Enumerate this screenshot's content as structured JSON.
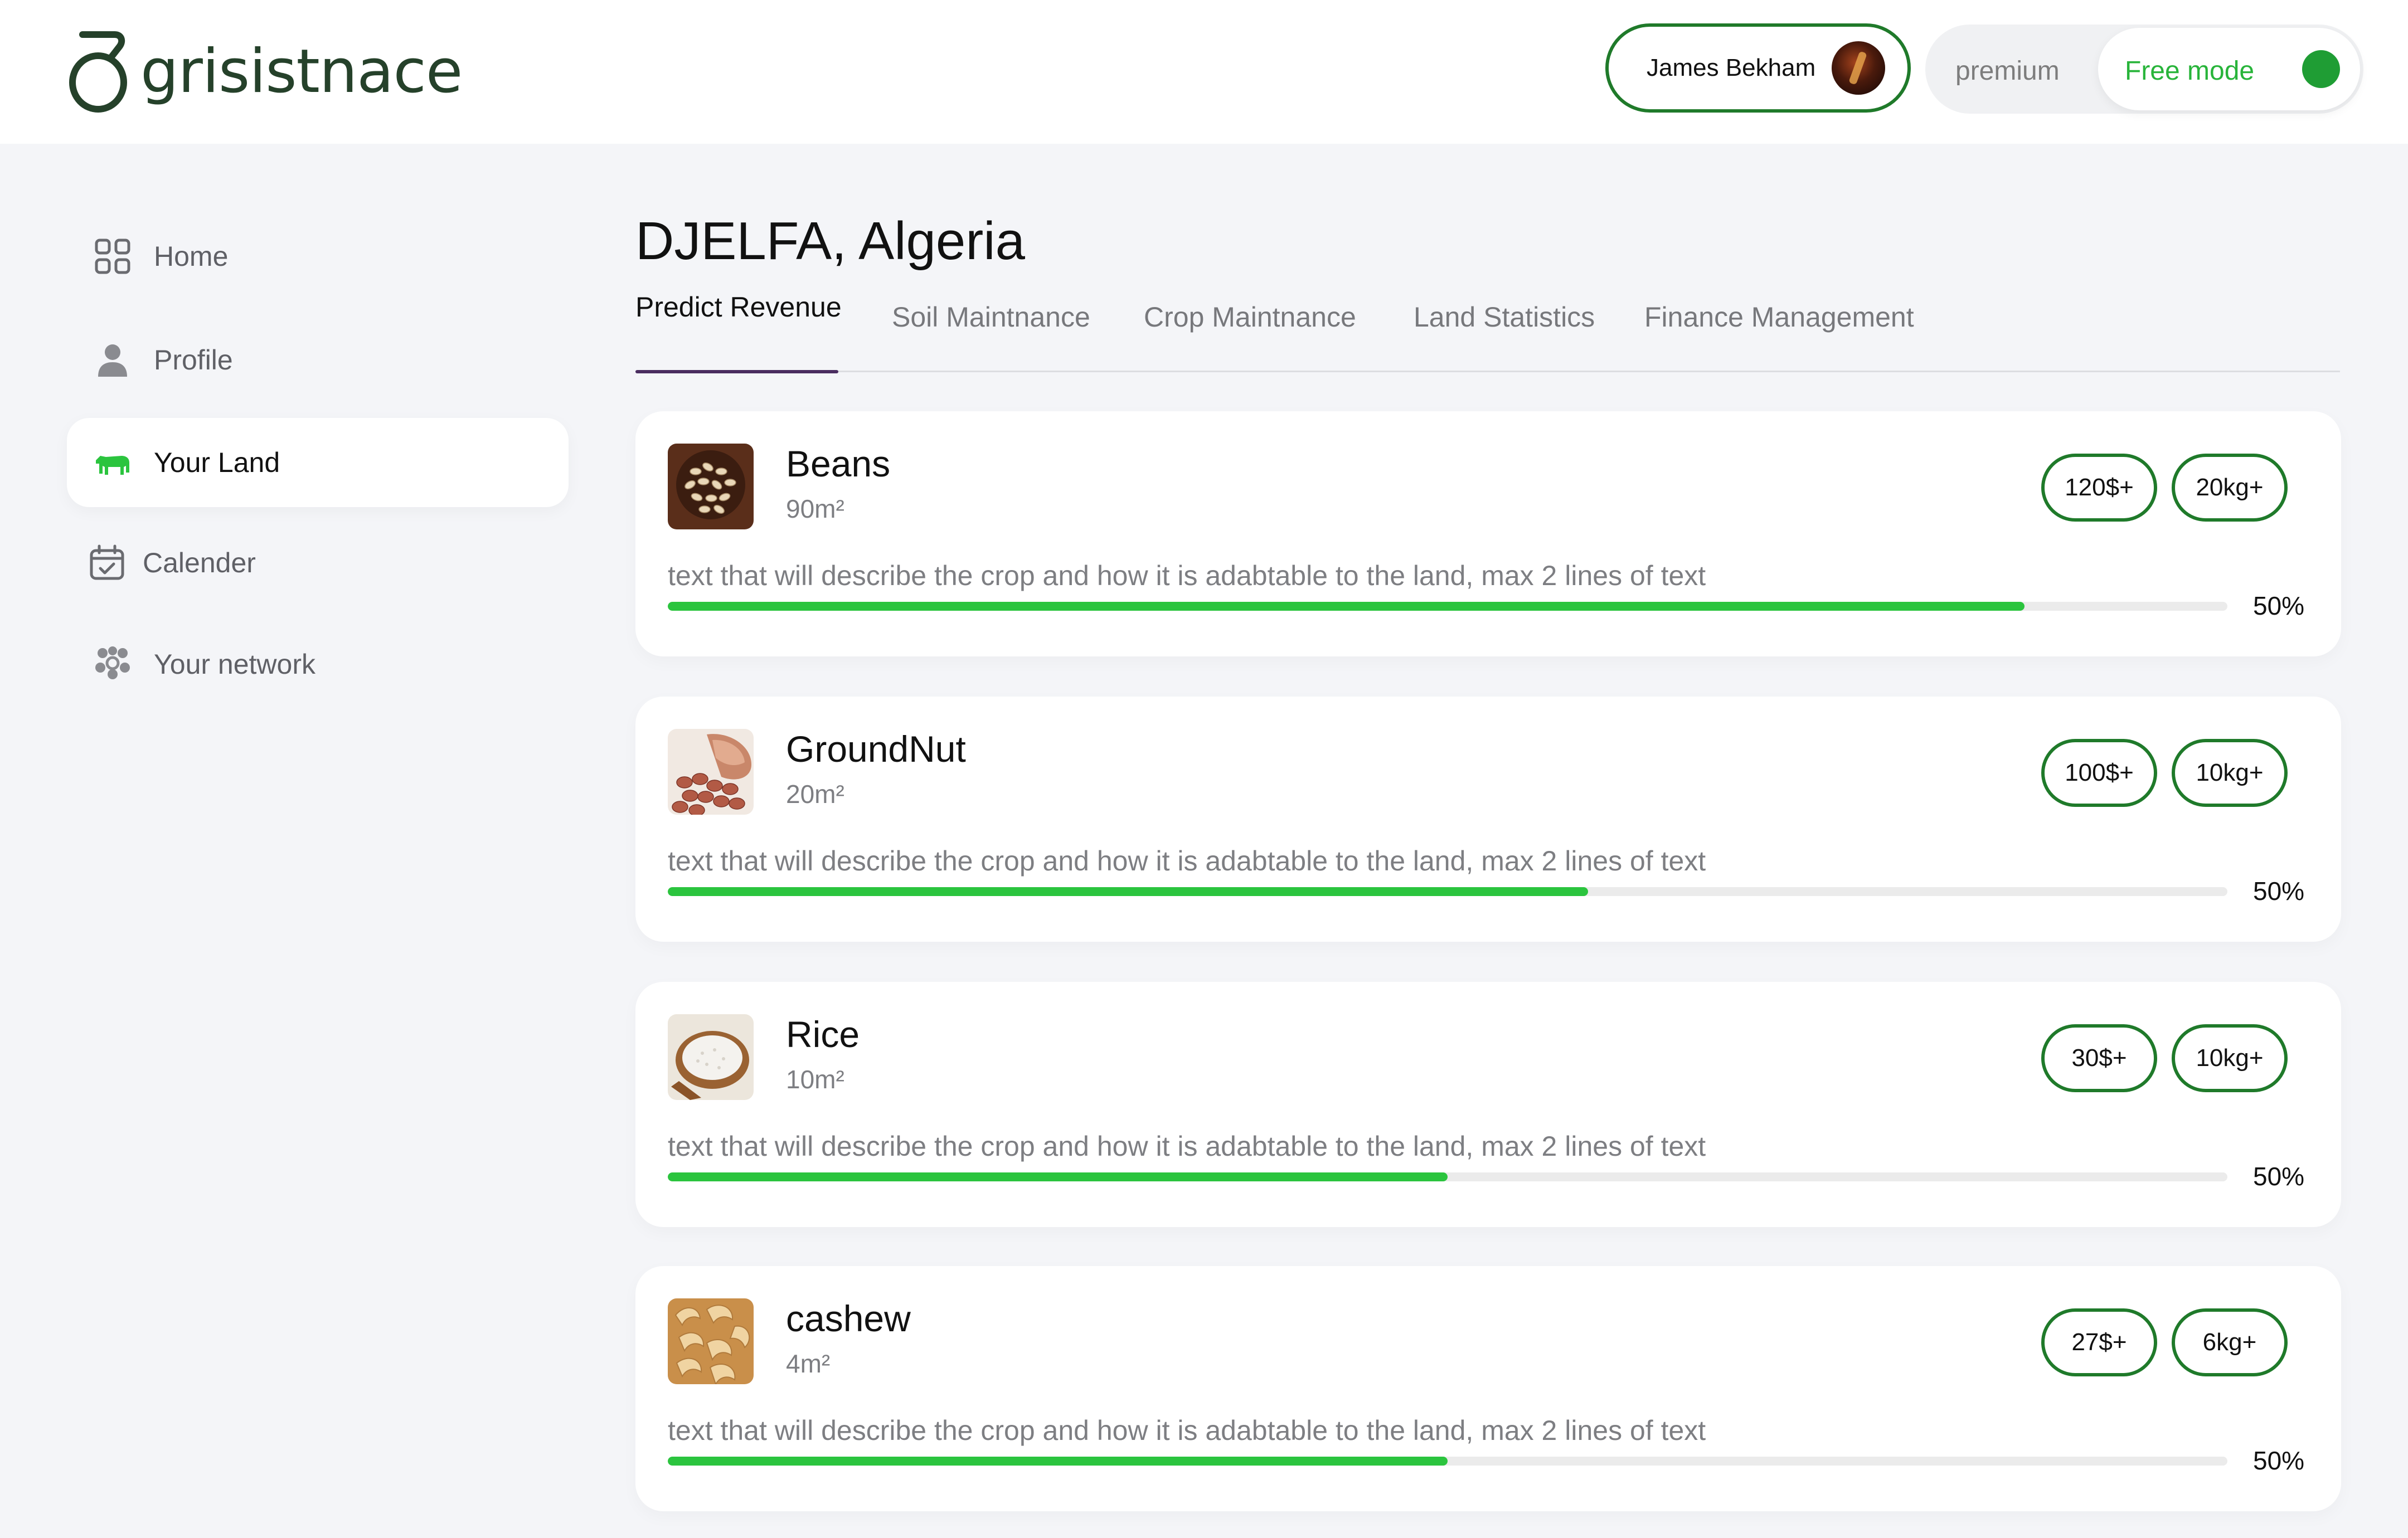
{
  "app": {
    "name": "grisistnace"
  },
  "header": {
    "user_name": "James Bekham",
    "mode": {
      "premium_label": "premium",
      "free_label": "Free mode"
    }
  },
  "sidebar": {
    "items": [
      {
        "label": "Home",
        "icon": "grid-icon",
        "active": false
      },
      {
        "label": "Profile",
        "icon": "person-icon",
        "active": false
      },
      {
        "label": "Your Land",
        "icon": "cow-icon",
        "active": true
      },
      {
        "label": "Calender",
        "icon": "calendar-check-icon",
        "active": false
      },
      {
        "label": "Your network",
        "icon": "network-icon",
        "active": false
      }
    ]
  },
  "main": {
    "title": "DJELFA, Algeria",
    "tabs": [
      {
        "label": "Predict Revenue",
        "active": true
      },
      {
        "label": "Soil Maintnance",
        "active": false
      },
      {
        "label": "Crop Maintnance",
        "active": false
      },
      {
        "label": "Land Statistics",
        "active": false
      },
      {
        "label": "Finance Management",
        "active": false
      }
    ],
    "crops": [
      {
        "name": "Beans",
        "area": "90m²",
        "revenue": "120$+",
        "yield": "20kg+",
        "description": "text that will describe the crop and how it is adabtable to the land, max 2 lines of text",
        "progress_label": "50%",
        "progress_fill": 0.87
      },
      {
        "name": "GroundNut",
        "area": "20m²",
        "revenue": "100$+",
        "yield": "10kg+",
        "description": "text that will describe the crop and how it is adabtable to the land, max 2 lines of text",
        "progress_label": "50%",
        "progress_fill": 0.59
      },
      {
        "name": "Rice",
        "area": "10m²",
        "revenue": "30$+",
        "yield": "10kg+",
        "description": "text that will describe the crop and how it is adabtable to the land, max 2 lines of text",
        "progress_label": "50%",
        "progress_fill": 0.5
      },
      {
        "name": "cashew",
        "area": "4m²",
        "revenue": "27$+",
        "yield": "6kg+",
        "description": "text that will describe the crop and how it is adabtable to the land, max 2 lines of text",
        "progress_label": "50%",
        "progress_fill": 0.5
      }
    ]
  },
  "colors": {
    "brand_green": "#25412a",
    "chip_border": "#1f7a2a",
    "progress": "#2bc43e",
    "active_tab_underline": "#4a2d60"
  }
}
